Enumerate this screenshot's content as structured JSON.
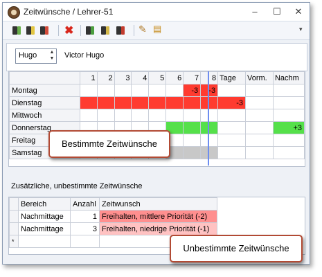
{
  "window": {
    "title": "Zeitwünsche / Lehrer-51",
    "buttons": {
      "minimize": "–",
      "maximize": "☐",
      "close": "✕"
    }
  },
  "toolbar": {
    "overflow": "▾"
  },
  "teacher": {
    "short": "Hugo",
    "full": "Victor Hugo"
  },
  "grid": {
    "columns": [
      "1",
      "2",
      "3",
      "4",
      "5",
      "6",
      "7",
      "8",
      "Tage",
      "Vorm.",
      "Nachm"
    ],
    "rows": [
      {
        "day": "Montag",
        "cells": [
          "",
          "",
          "",
          "",
          "",
          "",
          "-3",
          "-3",
          "",
          "",
          ""
        ]
      },
      {
        "day": "Dienstag",
        "cells": [
          "",
          "",
          "",
          "",
          "",
          "",
          "",
          "",
          "-3",
          "",
          ""
        ]
      },
      {
        "day": "Mittwoch",
        "cells": [
          "",
          "",
          "",
          "",
          "",
          "",
          "",
          "",
          "",
          "",
          ""
        ]
      },
      {
        "day": "Donnerstag",
        "cells": [
          "",
          "",
          "",
          "",
          "",
          "",
          "",
          "",
          "",
          "",
          "+3"
        ]
      },
      {
        "day": "Freitag",
        "cells": [
          "",
          "",
          "",
          "",
          "",
          "",
          "",
          "",
          "",
          "",
          ""
        ]
      },
      {
        "day": "Samstag",
        "cells": [
          "",
          "",
          "",
          "",
          "",
          "",
          "",
          "",
          "",
          "",
          ""
        ]
      }
    ],
    "colors": {
      "negative": "#ff3b30",
      "positive": "#55e04a",
      "blocked": "#c8c8c8"
    }
  },
  "section_label": "Zusätzliche, unbestimmte Zeitwünsche",
  "list": {
    "headers": [
      "Bereich",
      "Anzahl",
      "Zeitwunsch"
    ],
    "rows": [
      {
        "bereich": "Nachmittage",
        "anzahl": "1",
        "zeitwunsch": "Freihalten, mittlere Priorität (-2)"
      },
      {
        "bereich": "Nachmittage",
        "anzahl": "3",
        "zeitwunsch": "Freihalten, niedrige Priorität (-1)"
      }
    ],
    "new_row_marker": "*"
  },
  "callouts": {
    "bestimmte": "Bestimmte Zeitwünsche",
    "unbestimmte": "Unbestimmte Zeitwünsche"
  }
}
